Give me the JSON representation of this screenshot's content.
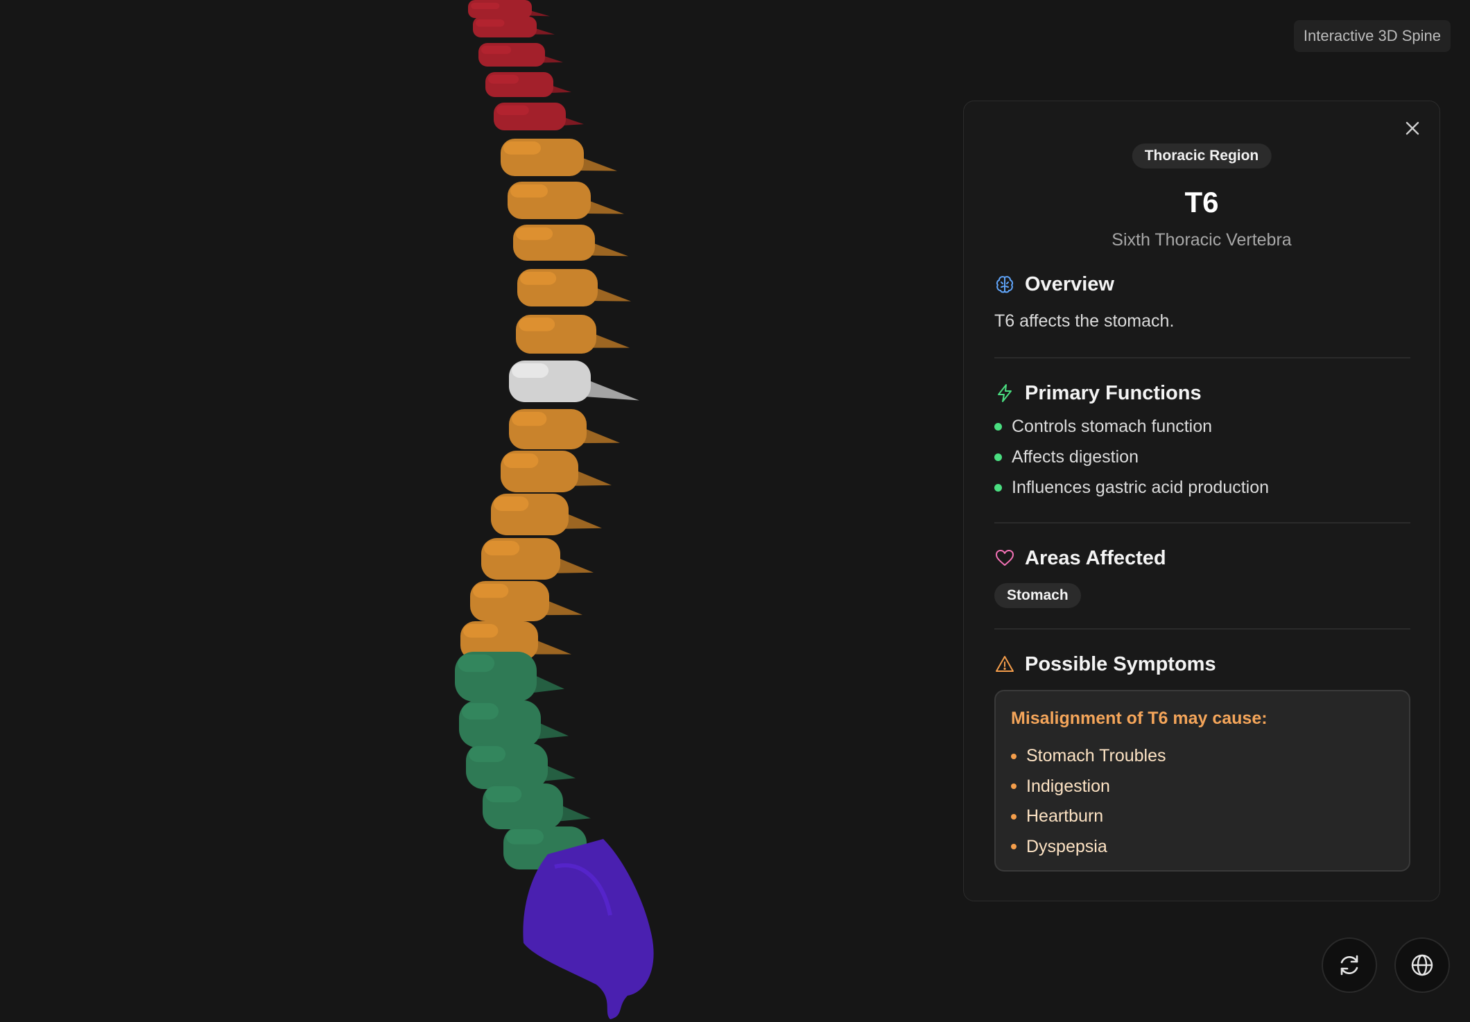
{
  "app": {
    "chip_label": "Interactive 3D Spine"
  },
  "spine": {
    "colors": {
      "cervical": "#a3202b",
      "thoracic": "#c9832c",
      "selected": "#d2d2d2",
      "lumbar": "#2f7a55",
      "sacrum": "#4a20b0"
    },
    "selected_vertebra": "T6"
  },
  "panel": {
    "region_badge": "Thoracic Region",
    "title": "T6",
    "subtitle": "Sixth Thoracic Vertebra",
    "overview": {
      "heading": "Overview",
      "icon": "brain-icon",
      "text": "T6 affects the stomach."
    },
    "functions": {
      "heading": "Primary Functions",
      "icon": "lightning-icon",
      "items": [
        "Controls stomach function",
        "Affects digestion",
        "Influences gastric acid production"
      ]
    },
    "areas": {
      "heading": "Areas Affected",
      "icon": "heart-icon",
      "tags": [
        "Stomach"
      ]
    },
    "symptoms": {
      "heading": "Possible Symptoms",
      "icon": "warning-icon",
      "intro": "Misalignment of T6 may cause:",
      "items": [
        "Stomach Troubles",
        "Indigestion",
        "Heartburn",
        "Dyspepsia"
      ]
    },
    "close_icon": "close-icon"
  },
  "controls": {
    "reset_view_icon": "refresh-icon",
    "globe_icon": "globe-icon"
  },
  "colors": {
    "background": "#161616",
    "panel": "#191919",
    "functions_accent": "#4ade80",
    "symptoms_accent": "#f59e4b",
    "overview_accent": "#60a5fa",
    "areas_accent": "#f472b6"
  }
}
